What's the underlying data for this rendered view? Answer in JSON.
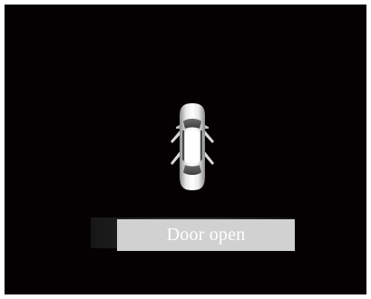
{
  "status": {
    "message": "Door open",
    "icon": "car-doors-open-icon"
  },
  "colors": {
    "background": "#070203",
    "message_box": "#d1d1d1",
    "message_text": "#ffffff",
    "frame": "#ffffff"
  }
}
